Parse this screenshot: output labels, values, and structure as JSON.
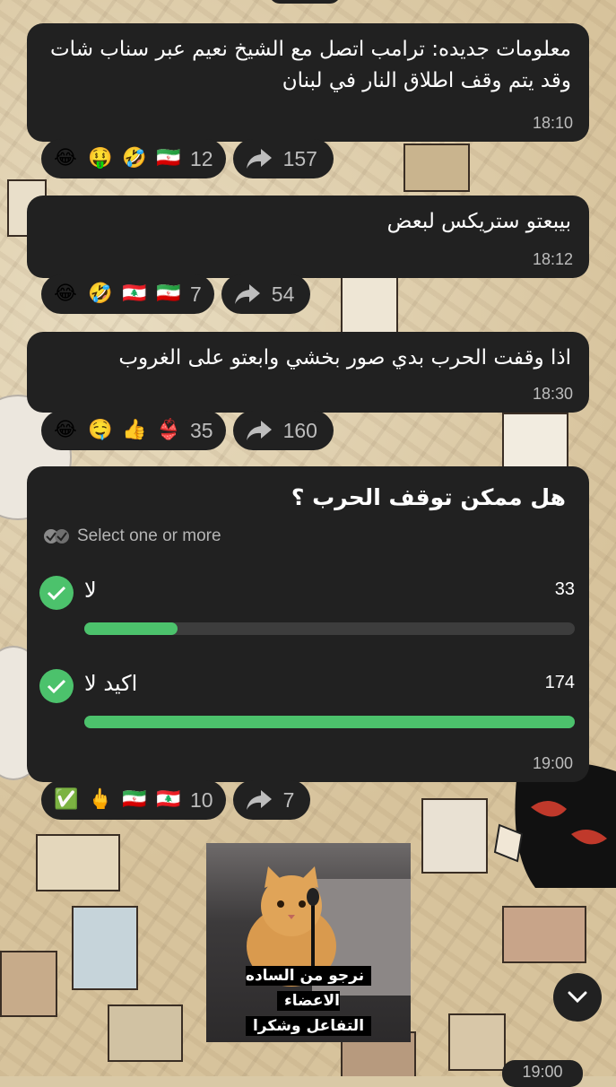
{
  "messages": [
    {
      "text": "معلومات جديده: ترامب اتصل مع الشيخ نعيم عبر سناب شات وقد يتم وقف اطلاق النار في لبنان",
      "time": "18:10",
      "reactions": {
        "emojis": [
          "😂",
          "🤑",
          "🤣",
          "🇮🇷"
        ],
        "count": "12",
        "shares": "157"
      }
    },
    {
      "text": "بيبعتو ستريكس لبعض",
      "time": "18:12",
      "reactions": {
        "emojis": [
          "😂",
          "🤣",
          "🇱🇧",
          "🇮🇷"
        ],
        "count": "7",
        "shares": "54"
      }
    },
    {
      "text": "اذا وقفت الحرب بدي صور بخشي وابعتو على الغروب",
      "time": "18:30",
      "reactions": {
        "emojis": [
          "😂",
          "🤤",
          "👍",
          "👙"
        ],
        "count": "35",
        "shares": "160"
      }
    }
  ],
  "poll": {
    "question": "هل ممكن توقف الحرب ؟",
    "subtitle": "Select one or more",
    "options": [
      {
        "label": "لا",
        "votes": "33",
        "fraction": 0.19
      },
      {
        "label": "اكيد لا",
        "votes": "174",
        "fraction": 1.0
      }
    ],
    "time": "19:00",
    "reactions": {
      "emojis": [
        "✅",
        "🖕",
        "🇮🇷",
        "🇱🇧"
      ],
      "count": "10",
      "shares": "7"
    }
  },
  "sticker": {
    "caption_line1": "نرجو من الساده الاعضاء",
    "caption_line2": "التفاعل وشكرا"
  },
  "bottom_time": "19:00",
  "colors": {
    "bubble": "#212121",
    "accent": "#4cc26c",
    "muted": "#bdbdbd"
  }
}
